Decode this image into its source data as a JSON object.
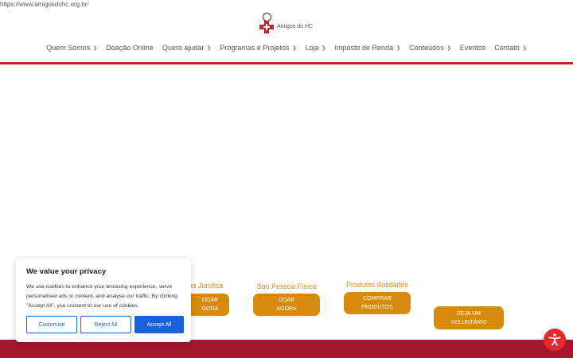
{
  "browser": {
    "url": "https://www.amigosdohc.org.br/"
  },
  "brand": {
    "name": "Amigos do HC"
  },
  "nav": {
    "items": [
      {
        "label": "Quem Somos",
        "dropdown": true
      },
      {
        "label": "Doação Online",
        "dropdown": false
      },
      {
        "label": "Quero ajudar",
        "dropdown": true
      },
      {
        "label": "Programas e Projetos",
        "dropdown": true
      },
      {
        "label": "Loja",
        "dropdown": true
      },
      {
        "label": "Imposto de Renda",
        "dropdown": true
      },
      {
        "label": "Conteúdos",
        "dropdown": true
      },
      {
        "label": "Eventos",
        "dropdown": false
      },
      {
        "label": "Contato",
        "dropdown": true
      }
    ]
  },
  "ctas": {
    "juridica": {
      "title": "soa Jurídica",
      "button_line1": "DOAR",
      "button_line2": "GORA"
    },
    "fisica": {
      "title": "Sou Pessoa Física",
      "button_line1": "DOAR",
      "button_line2": "AGORA"
    },
    "produtos": {
      "title": "Produtos Solidários",
      "button_line1": "COMPRAR",
      "button_line2": "PRODUTOS"
    },
    "voluntario": {
      "button_line1": "SEJA UM",
      "button_line2": "VOLUNTÁRIO"
    }
  },
  "cookie": {
    "title": "We value your privacy",
    "text": "We use cookies to enhance your browsing experience, serve personalised ads or content, and analyse our traffic. By clicking \"Accept All\", you consent to our use of cookies.",
    "customise": "Customise",
    "reject": "Reject All",
    "accept": "Accept All"
  },
  "colors": {
    "brand_red": "#c0262d",
    "footer_red": "#a5162f",
    "cta_orange": "#d88a0c",
    "cookie_blue": "#1863dc",
    "a11y_red": "#e32b2b"
  },
  "icons": {
    "accessibility": "accessibility-icon",
    "chevron": "chevron-down-icon"
  }
}
